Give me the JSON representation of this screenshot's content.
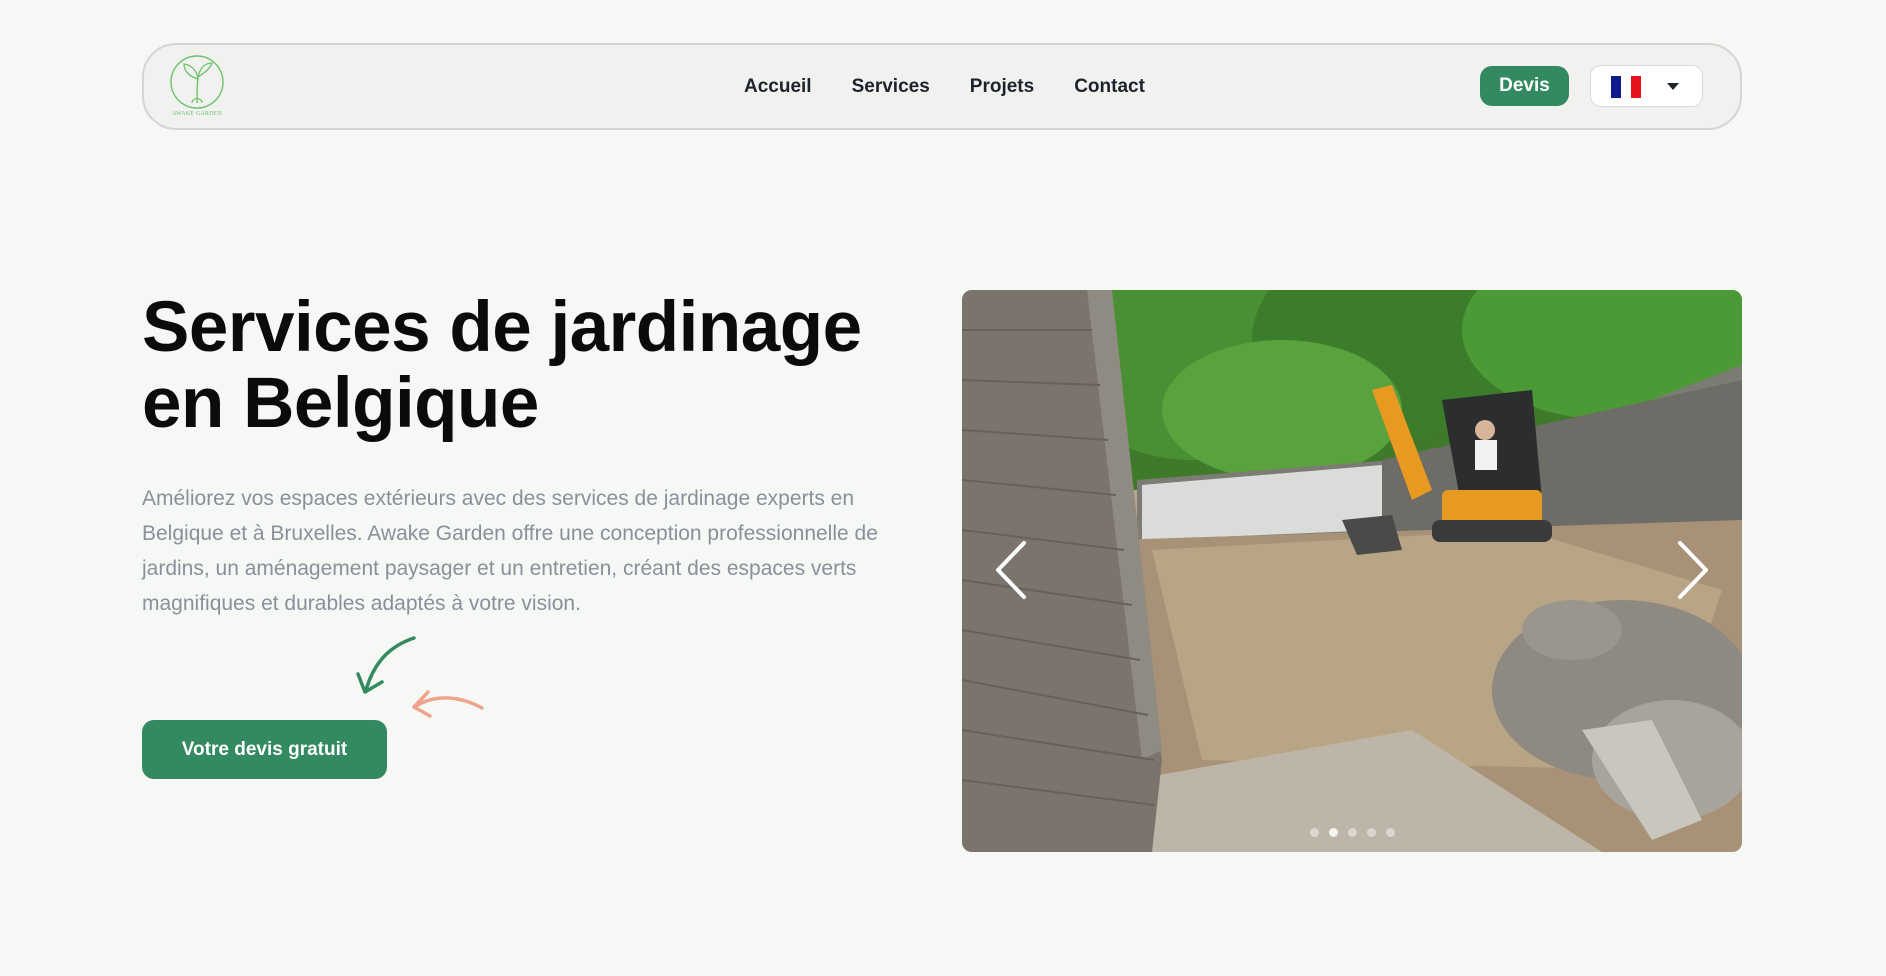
{
  "header": {
    "logo_text": "AWAKE GARDEN",
    "nav": [
      {
        "label": "Accueil"
      },
      {
        "label": "Services"
      },
      {
        "label": "Projets"
      },
      {
        "label": "Contact"
      }
    ],
    "devis_label": "Devis",
    "language": {
      "selected_flag": "flag-france-icon",
      "dropdown_icon": "caret-down-icon"
    }
  },
  "hero": {
    "title_line1": "Services de jardinage",
    "title_line2": "en Belgique",
    "description": "Améliorez vos espaces extérieurs avec des services de jardinage experts en Belgique et à Bruxelles. Awake Garden offre une conception professionnelle de jardins, un aménagement paysager et un entretien, créant des espaces verts magnifiques et durables adaptés à votre vision.",
    "cta_label": "Votre devis gratuit"
  },
  "carousel": {
    "prev_icon": "chevron-left-icon",
    "next_icon": "chevron-right-icon",
    "slide_count": 5,
    "active_slide": 1
  },
  "colors": {
    "brand_green": "#348a60",
    "accent_salmon": "#f0a48c",
    "logo_green": "#6cc26a",
    "page_background": "#f6f8f5",
    "body_text_grey": "#8a909a"
  }
}
